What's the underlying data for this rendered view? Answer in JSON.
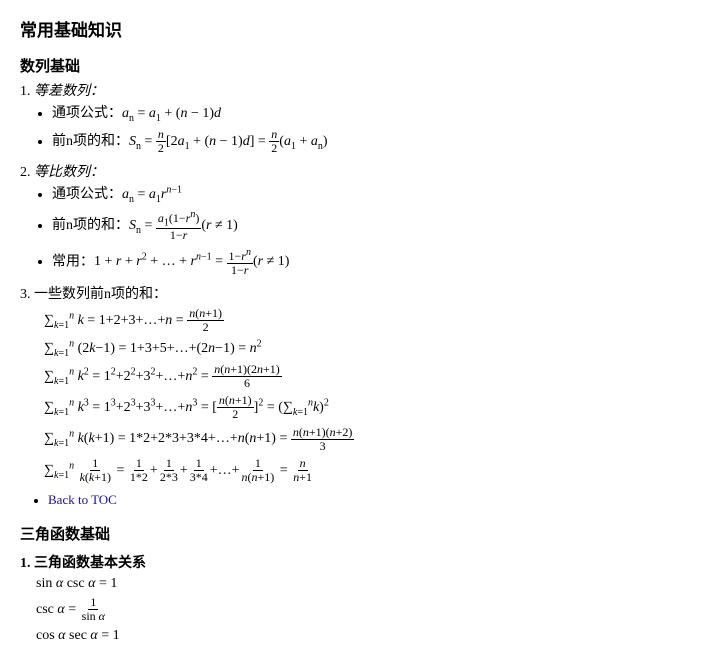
{
  "page": {
    "title": "常用基础知识",
    "sections": [
      {
        "id": "sequences",
        "label": "数列基础",
        "items": [
          {
            "number": "1",
            "title": "等差数列：",
            "bullets": [
              "通项公式：a_n = a_1 + (n-1)d",
              "前n项的和：S_n = n/2[2a_1 + (n-1)d] = n/2(a_1 + a_n)"
            ]
          },
          {
            "number": "2",
            "title": "等比数列：",
            "bullets": [
              "通项公式：a_n = a_1·r^(n-1)",
              "前n项的和：S_n = a_1(1-r^n)/(1-r) (r≠1)",
              "常用：1 + r + r² + ... + r^(n-1) = (1-r^n)/(1-r) (r≠1)"
            ]
          },
          {
            "number": "3",
            "title": "一些数列前n项的和：",
            "subitems": [
              "∑_{k=1}^n k = 1+2+3+...+n = n(n+1)/2",
              "∑_{k=1}^n (2k-1) = 1+3+5+...+(2n-1) = n²",
              "∑_{k=1}^n k² = 1²+2²+3²+...+n² = n(n+1)(2n+1)/6",
              "∑_{k=1}^n k³ = 1³+2³+3³+...+n³ = [n(n+1)/2]² = (∑_{k=1}^n k)²",
              "∑_{k=1}^n k(k+1) = 1*2+2*3+3*4+...+n(n+1) = n(n+1)(n+2)/3",
              "∑_{k=1}^n 1/(k(k+1)) = 1/(1*2)+1/(2*3)+1/(3*4)+...+1/(n(n+1)) = n/(n+1)"
            ]
          }
        ],
        "backLink": "Back to TOC"
      },
      {
        "id": "trig",
        "label": "三角函数基础",
        "subsections": [
          {
            "number": "1",
            "title": "三角函数基本关系",
            "items": [
              "sin α csc α = 1",
              "csc α = 1/sin α",
              "cos α sec α = 1"
            ]
          }
        ]
      }
    ]
  }
}
